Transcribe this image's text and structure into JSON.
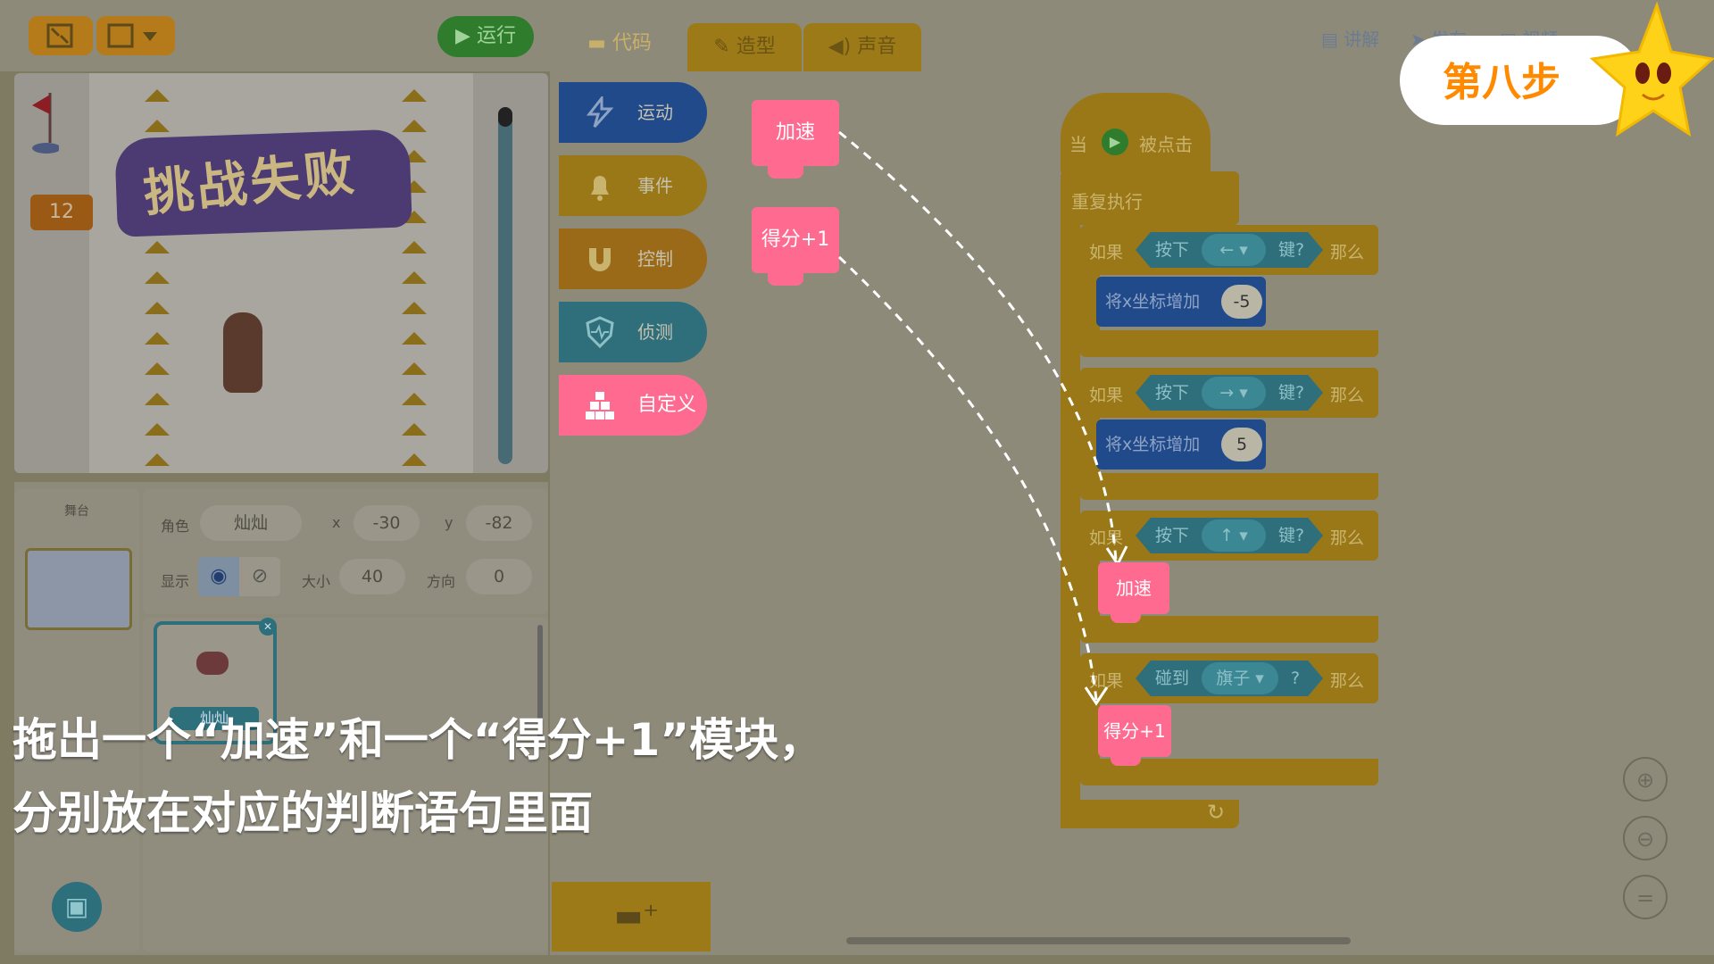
{
  "toolbar": {
    "run_label": "运行",
    "right_links": [
      "讲解",
      "发布",
      "视频"
    ]
  },
  "tabs": [
    {
      "label": "代码"
    },
    {
      "label": "造型"
    },
    {
      "label": "声音"
    }
  ],
  "categories": [
    {
      "label": "运动",
      "icon": "motion-icon",
      "color": "#214a8a"
    },
    {
      "label": "事件",
      "icon": "bell-icon",
      "color": "#9a7818"
    },
    {
      "label": "控制",
      "icon": "magnet-icon",
      "color": "#9a6a18"
    },
    {
      "label": "侦测",
      "icon": "shield-icon",
      "color": "#2e6f7b"
    },
    {
      "label": "自定义",
      "icon": "blocks-icon",
      "color": "#ff6b90"
    }
  ],
  "stage": {
    "score": "12",
    "banner_text": "挑战失败"
  },
  "stage_panel": {
    "label": "舞台"
  },
  "sprite": {
    "role_label": "角色",
    "role_name": "灿灿",
    "x_label": "x",
    "x_value": "-30",
    "y_label": "y",
    "y_value": "-82",
    "show_label": "显示",
    "size_label": "大小",
    "size_value": "40",
    "dir_label": "方向",
    "dir_value": "0",
    "card_name": "灿灿"
  },
  "palette_blocks": [
    {
      "label": "加速"
    },
    {
      "label": "得分+1"
    }
  ],
  "script": {
    "hat_when": "当",
    "hat_clicked": "被点击",
    "forever": "重复执行",
    "if": "如果",
    "then": "那么",
    "key_pressed": "按下",
    "key_suffix": "键?",
    "keys": [
      "←",
      "→",
      "↑"
    ],
    "change_x": "将x坐标增加",
    "change_values": [
      "-5",
      "5"
    ],
    "touching": "碰到",
    "touch_target": "旗子",
    "touch_suffix": "?",
    "accel": "加速",
    "score_plus": "得分+1"
  },
  "caption": {
    "line1": "拖出一个“加速”和一个“得分+1”模块，",
    "line2": "分别放在对应的判断语句里面"
  },
  "badge": {
    "label": "第八步"
  },
  "colors": {
    "highlight_pink": "#ff6b90",
    "badge_orange": "#ff8a00"
  }
}
